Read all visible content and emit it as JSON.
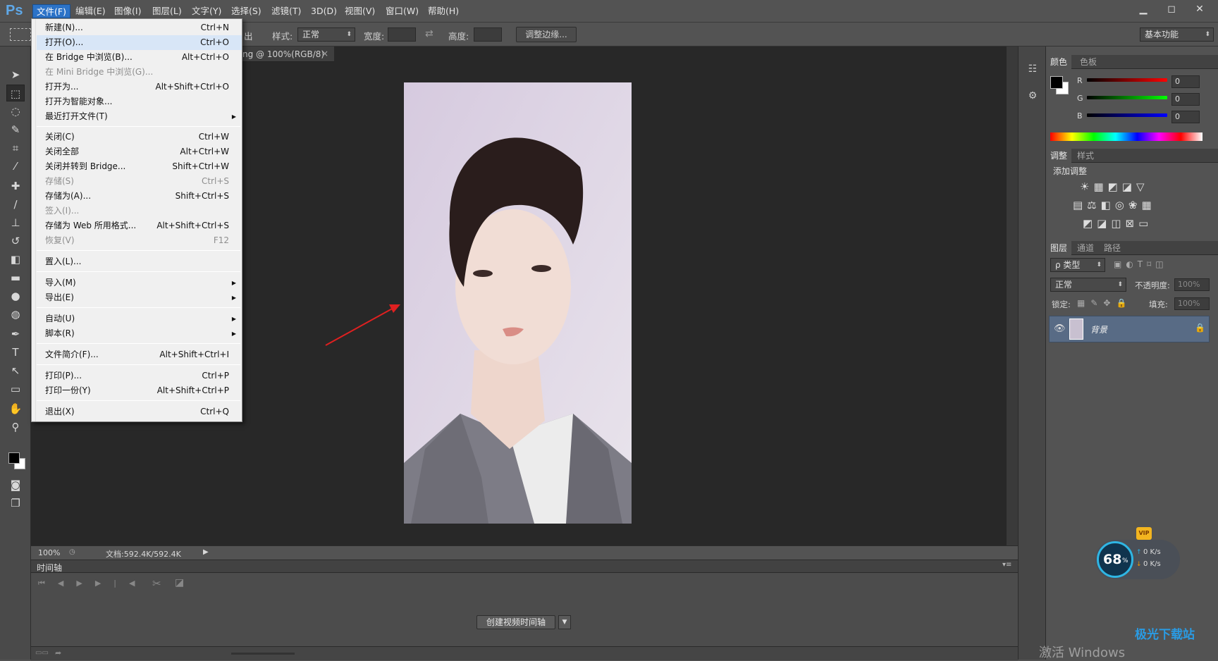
{
  "app": {
    "logo": "Ps"
  },
  "menubar": [
    {
      "label": "文件(F)"
    },
    {
      "label": "编辑(E)"
    },
    {
      "label": "图像(I)"
    },
    {
      "label": "图层(L)"
    },
    {
      "label": "文字(Y)"
    },
    {
      "label": "选择(S)"
    },
    {
      "label": "滤镜(T)"
    },
    {
      "label": "3D(D)"
    },
    {
      "label": "视图(V)"
    },
    {
      "label": "窗口(W)"
    },
    {
      "label": "帮助(H)"
    }
  ],
  "window_controls": {
    "minimize": "▁",
    "restore": "◻",
    "close": "✕"
  },
  "options": {
    "partial_label": "出",
    "style_label": "样式:",
    "style_value": "正常",
    "width_label": "宽度:",
    "height_label": "高度:",
    "refine_button": "调整边缘...",
    "workspace": "基本功能"
  },
  "doc_tab": {
    "title": "ng @ 100%(RGB/8)",
    "close": "×"
  },
  "file_menu": {
    "items": [
      {
        "label": "新建(N)...",
        "shortcut": "Ctrl+N"
      },
      {
        "label": "打开(O)...",
        "shortcut": "Ctrl+O"
      },
      {
        "label": "在 Bridge 中浏览(B)...",
        "shortcut": "Alt+Ctrl+O"
      },
      {
        "label": "在 Mini Bridge 中浏览(G)...",
        "shortcut": ""
      },
      {
        "label": "打开为...",
        "shortcut": "Alt+Shift+Ctrl+O"
      },
      {
        "label": "打开为智能对象...",
        "shortcut": ""
      },
      {
        "label": "最近打开文件(T)",
        "shortcut": ""
      },
      {
        "label": "关闭(C)",
        "shortcut": "Ctrl+W"
      },
      {
        "label": "关闭全部",
        "shortcut": "Alt+Ctrl+W"
      },
      {
        "label": "关闭并转到 Bridge...",
        "shortcut": "Shift+Ctrl+W"
      },
      {
        "label": "存储(S)",
        "shortcut": "Ctrl+S"
      },
      {
        "label": "存储为(A)...",
        "shortcut": "Shift+Ctrl+S"
      },
      {
        "label": "签入(I)...",
        "shortcut": ""
      },
      {
        "label": "存储为 Web 所用格式...",
        "shortcut": "Alt+Shift+Ctrl+S"
      },
      {
        "label": "恢复(V)",
        "shortcut": "F12"
      },
      {
        "label": "置入(L)...",
        "shortcut": ""
      },
      {
        "label": "导入(M)",
        "shortcut": ""
      },
      {
        "label": "导出(E)",
        "shortcut": ""
      },
      {
        "label": "自动(U)",
        "shortcut": ""
      },
      {
        "label": "脚本(R)",
        "shortcut": ""
      },
      {
        "label": "文件简介(F)...",
        "shortcut": "Alt+Shift+Ctrl+I"
      },
      {
        "label": "打印(P)...",
        "shortcut": "Ctrl+P"
      },
      {
        "label": "打印一份(Y)",
        "shortcut": "Alt+Shift+Ctrl+P"
      },
      {
        "label": "退出(X)",
        "shortcut": "Ctrl+Q"
      }
    ]
  },
  "status": {
    "zoom": "100%",
    "doc": "文档:592.4K/592.4K"
  },
  "timeline": {
    "title": "时间轴",
    "create_button": "创建视频时间轴"
  },
  "color_panel": {
    "tabs": [
      "颜色",
      "色板"
    ],
    "r_label": "R",
    "g_label": "G",
    "b_label": "B",
    "r": "0",
    "g": "0",
    "b": "0"
  },
  "adjust_panel": {
    "tabs": [
      "调整",
      "样式"
    ],
    "add_label": "添加调整"
  },
  "layers_panel": {
    "tabs": [
      "图层",
      "通道",
      "路径"
    ],
    "filter": "ρ 类型",
    "blend": "正常",
    "opacity_label": "不透明度:",
    "opacity": "100%",
    "lock_label": "锁定:",
    "fill_label": "填充:",
    "fill": "100%",
    "layer_name": "背景"
  },
  "widget": {
    "percent": "68",
    "pct_sign": "%",
    "up": "0 K/s",
    "down": "0 K/s",
    "badge": "VIP"
  },
  "watermark": {
    "activate": "激活 Windows",
    "site": "极光下载站"
  },
  "colors": {
    "accent": "#2c73c8",
    "menu_bg": "#f0f0f0",
    "panel": "#535353",
    "canvas": "#282828"
  }
}
